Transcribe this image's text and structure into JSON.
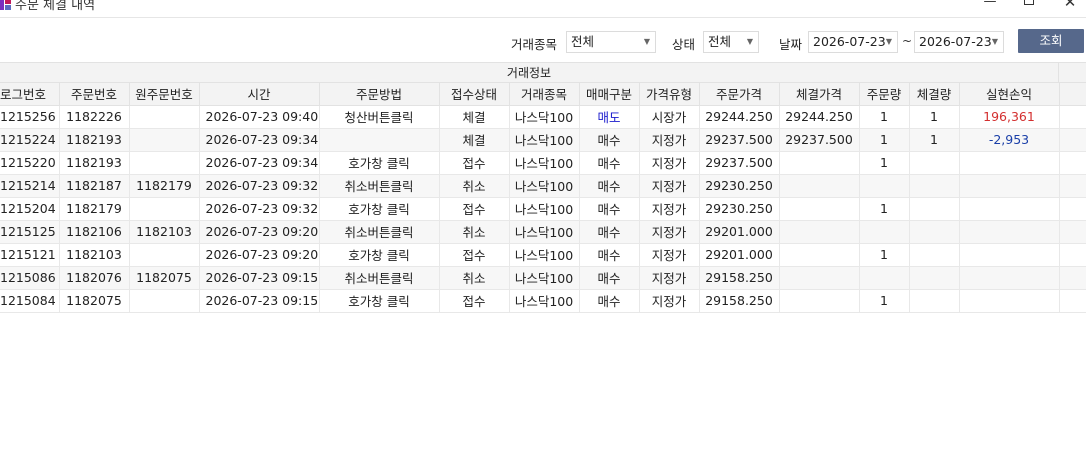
{
  "window": {
    "title": "주문 체결 내역",
    "min_glyph": "—",
    "close_glyph": "✕"
  },
  "filters": {
    "symbol_label": "거래종목",
    "symbol_value": "전체",
    "status_label": "상태",
    "status_value": "전체",
    "date_label": "날짜",
    "date_from": "2026-07-23",
    "date_to": "2026-07-23",
    "tilde": "~",
    "query_button": "조회"
  },
  "grid": {
    "group_header": "거래정보",
    "columns": [
      "로그번호",
      "주문번호",
      "원주문번호",
      "시간",
      "주문방법",
      "접수상태",
      "거래종목",
      "매매구분",
      "가격유형",
      "주문가격",
      "체결가격",
      "주문량",
      "체결량",
      "실현손익"
    ],
    "rows": [
      [
        "1215256",
        "1182226",
        "",
        "2026-07-23 09:40...",
        "청산버튼클릭",
        "체결",
        "나스닥100",
        "매도",
        "시장가",
        "29244.250",
        "29244.250",
        "1",
        "1",
        "196,361"
      ],
      [
        "1215224",
        "1182193",
        "",
        "2026-07-23 09:34...",
        "",
        "체결",
        "나스닥100",
        "매수",
        "지정가",
        "29237.500",
        "29237.500",
        "1",
        "1",
        "-2,953"
      ],
      [
        "1215220",
        "1182193",
        "",
        "2026-07-23 09:34...",
        "호가창 클릭",
        "접수",
        "나스닥100",
        "매수",
        "지정가",
        "29237.500",
        "",
        "1",
        "",
        ""
      ],
      [
        "1215214",
        "1182187",
        "1182179",
        "2026-07-23 09:32...",
        "취소버튼클릭",
        "취소",
        "나스닥100",
        "매수",
        "지정가",
        "29230.250",
        "",
        "",
        "",
        ""
      ],
      [
        "1215204",
        "1182179",
        "",
        "2026-07-23 09:32...",
        "호가창 클릭",
        "접수",
        "나스닥100",
        "매수",
        "지정가",
        "29230.250",
        "",
        "1",
        "",
        ""
      ],
      [
        "1215125",
        "1182106",
        "1182103",
        "2026-07-23 09:20...",
        "취소버튼클릭",
        "취소",
        "나스닥100",
        "매수",
        "지정가",
        "29201.000",
        "",
        "",
        "",
        ""
      ],
      [
        "1215121",
        "1182103",
        "",
        "2026-07-23 09:20...",
        "호가창 클릭",
        "접수",
        "나스닥100",
        "매수",
        "지정가",
        "29201.000",
        "",
        "1",
        "",
        ""
      ],
      [
        "1215086",
        "1182076",
        "1182075",
        "2026-07-23 09:15...",
        "취소버튼클릭",
        "취소",
        "나스닥100",
        "매수",
        "지정가",
        "29158.250",
        "",
        "",
        "",
        ""
      ],
      [
        "1215084",
        "1182075",
        "",
        "2026-07-23 09:15...",
        "호가창 클릭",
        "접수",
        "나스닥100",
        "매수",
        "지정가",
        "29158.250",
        "",
        "1",
        "",
        ""
      ]
    ]
  },
  "colors": {
    "sell": "#1a1acc",
    "profit_positive": "#d32f2f",
    "profit_negative": "#1a3fa8",
    "query_button_bg": "#56688b"
  }
}
